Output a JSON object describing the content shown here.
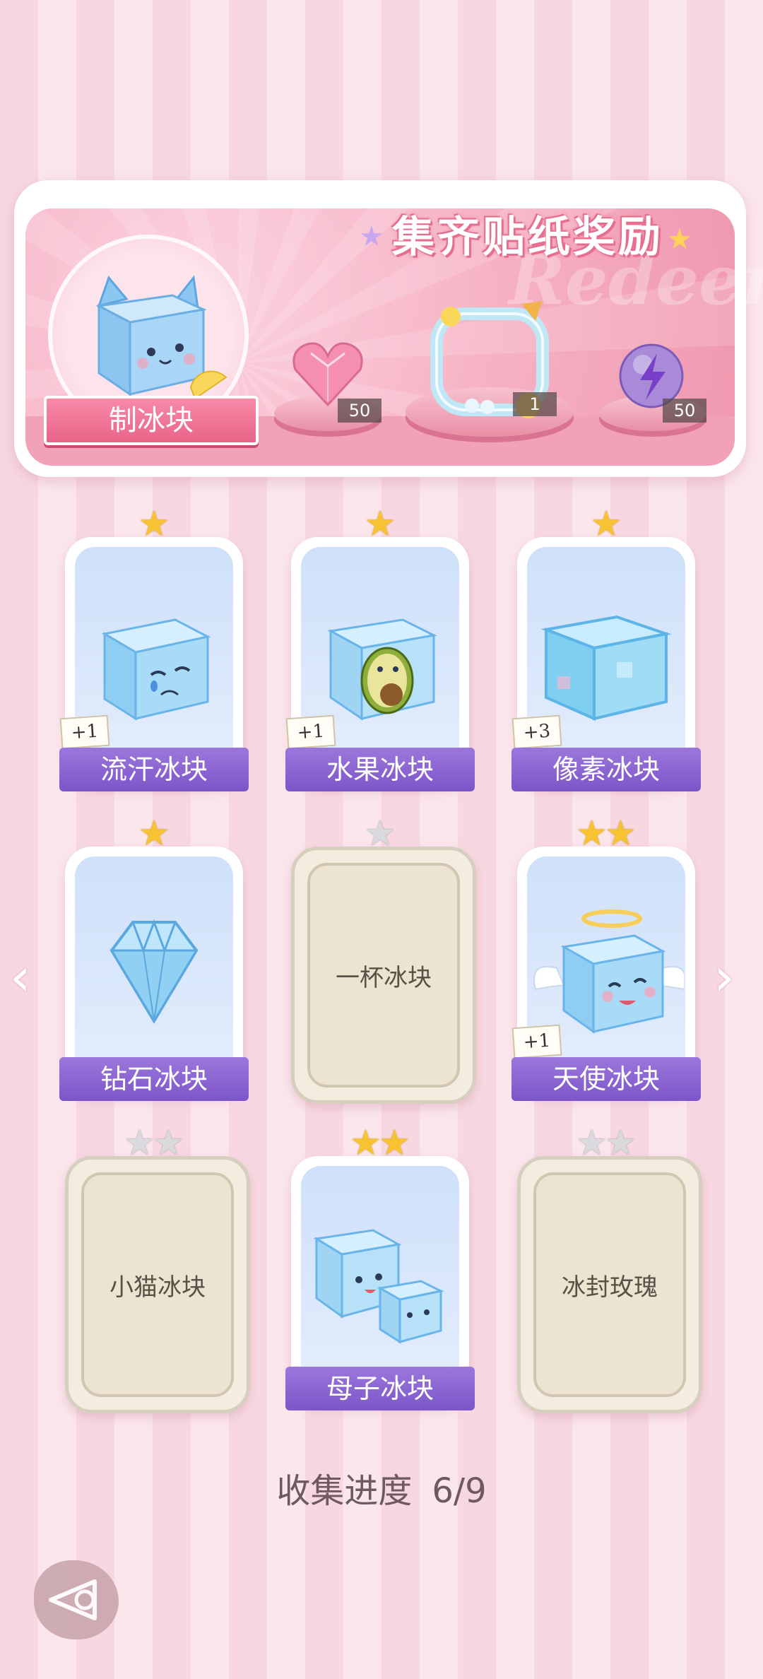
{
  "banner": {
    "title": "集齐贴纸奖励",
    "watermark": "Redeem",
    "maker_label": "制冰块",
    "rewards": [
      {
        "icon": "pink-heart-gem-icon",
        "count": "50"
      },
      {
        "icon": "lemonade-frame-icon",
        "count": "1"
      },
      {
        "icon": "purple-lightning-orb-icon",
        "count": "50"
      }
    ]
  },
  "cards": [
    {
      "name": "流汗冰块",
      "stars": 1,
      "star_state": "gold",
      "plus": "+1",
      "locked": false,
      "icon": "sweating-ice-cube-icon"
    },
    {
      "name": "水果冰块",
      "stars": 1,
      "star_state": "gold",
      "plus": "+1",
      "locked": false,
      "icon": "avocado-ice-cube-icon"
    },
    {
      "name": "像素冰块",
      "stars": 1,
      "star_state": "gold",
      "plus": "+3",
      "locked": false,
      "icon": "pixel-ice-cube-icon"
    },
    {
      "name": "钻石冰块",
      "stars": 1,
      "star_state": "gold",
      "plus": "",
      "locked": false,
      "icon": "diamond-ice-icon"
    },
    {
      "name": "一杯冰块",
      "stars": 1,
      "star_state": "grey",
      "plus": "",
      "locked": true,
      "icon": ""
    },
    {
      "name": "天使冰块",
      "stars": 2,
      "star_state": "gold",
      "plus": "+1",
      "locked": false,
      "icon": "angel-ice-cube-icon"
    },
    {
      "name": "小猫冰块",
      "stars": 2,
      "star_state": "grey",
      "plus": "",
      "locked": true,
      "icon": ""
    },
    {
      "name": "母子冰块",
      "stars": 2,
      "star_state": "gold",
      "plus": "",
      "locked": false,
      "icon": "mother-child-ice-cubes-icon"
    },
    {
      "name": "冰封玫瑰",
      "stars": 2,
      "star_state": "grey",
      "plus": "",
      "locked": true,
      "icon": ""
    }
  ],
  "progress": {
    "label": "收集进度",
    "value": "6/9"
  },
  "nav": {
    "prev_icon": "chevron-left-icon",
    "next_icon": "chevron-right-icon",
    "back_icon": "back-arrow-icon"
  }
}
